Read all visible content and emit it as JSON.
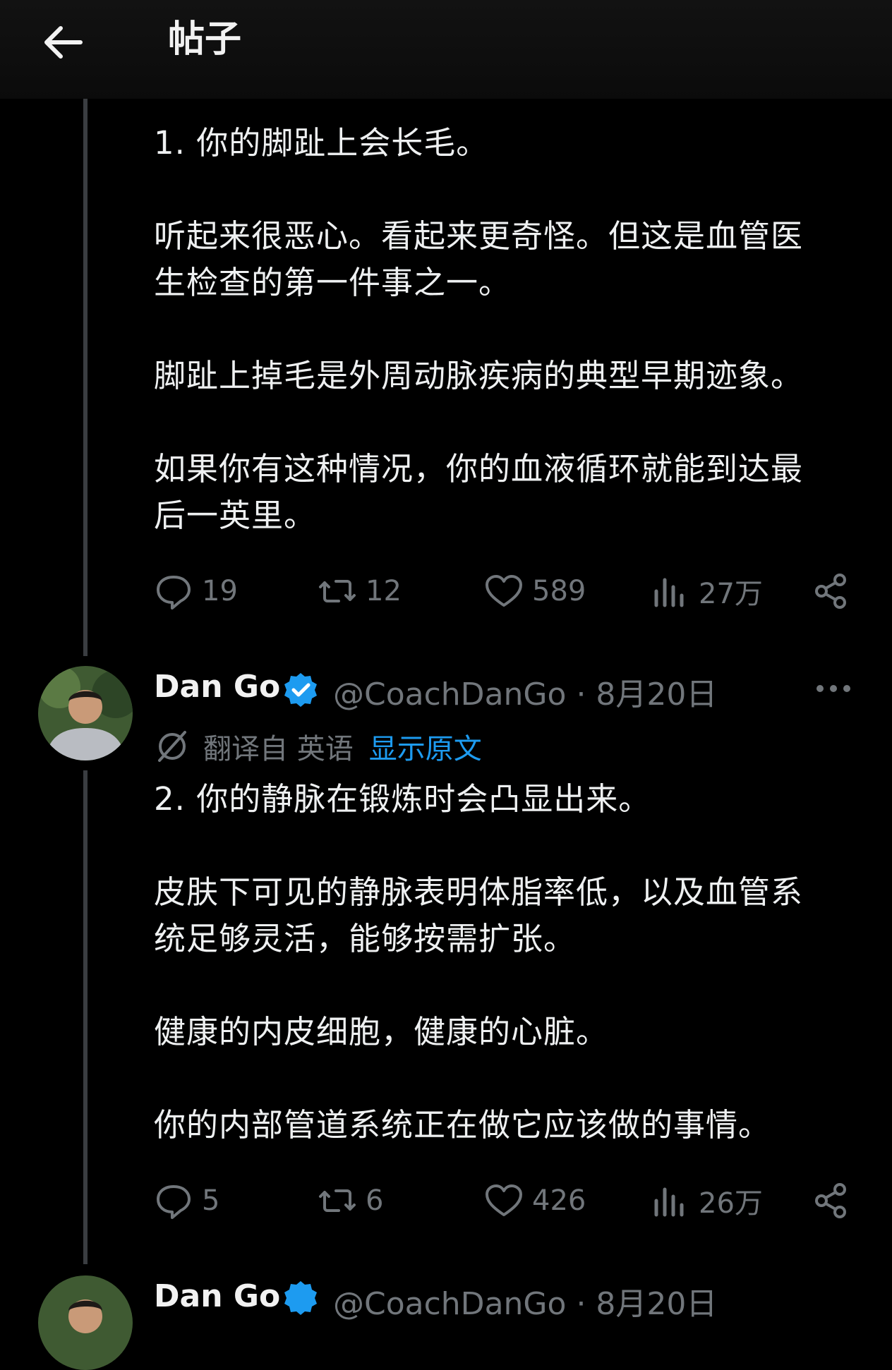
{
  "header": {
    "title": "帖子"
  },
  "post1": {
    "paragraphs": [
      [
        "1. 你的脚趾上会长毛。"
      ],
      [
        "听起来很恶心。看起来更奇怪。但这是血管医",
        "生检查的第一件事之一。"
      ],
      [
        "脚趾上掉毛是外周动脉疾病的典型早期迹象。"
      ],
      [
        "如果你有这种情况，你的血液循环就能到达最",
        "后一英里。"
      ]
    ],
    "actions": {
      "replies": "19",
      "reposts": "12",
      "likes": "589",
      "views": "27万"
    }
  },
  "post2": {
    "author": {
      "name": "Dan Go",
      "handle": "@CoachDanGo",
      "date": "8月20日"
    },
    "translation": {
      "label": "翻译自 英语",
      "show_original": "显示原文"
    },
    "paragraphs": [
      [
        "2. 你的静脉在锻炼时会凸显出来。"
      ],
      [
        "皮肤下可见的静脉表明体脂率低，以及血管系",
        "统足够灵活，能够按需扩张。"
      ],
      [
        "健康的内皮细胞，健康的心脏。"
      ],
      [
        "你的内部管道系统正在做它应该做的事情。"
      ]
    ],
    "actions": {
      "replies": "5",
      "reposts": "6",
      "likes": "426",
      "views": "26万"
    }
  },
  "post3": {
    "author": {
      "name": "Dan Go",
      "handle": "@CoachDanGo",
      "date": "8月20日"
    }
  },
  "colors": {
    "background": "#000000",
    "text": "#e7e9ea",
    "muted": "#71767b",
    "link": "#1d9bf0",
    "verified": "#1d9bf0"
  },
  "icons": [
    "back-arrow-icon",
    "reply-icon",
    "repost-icon",
    "like-icon",
    "views-icon",
    "share-icon",
    "verified-badge-icon",
    "translate-icon",
    "more-icon"
  ]
}
